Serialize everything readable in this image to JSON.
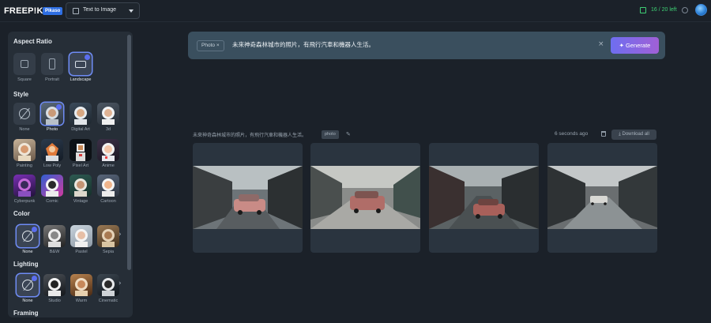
{
  "topbar": {
    "logo": "FREEP!K",
    "badge": "Pikaso",
    "mode": "Text to Image",
    "credits": "16 / 20 left"
  },
  "sidebar": {
    "aspect_title": "Aspect Ratio",
    "aspect_options": [
      "Square",
      "Portrait",
      "Landscape"
    ],
    "style_title": "Style",
    "style_options": [
      "None",
      "Photo",
      "Digital Art",
      "3d",
      "Painting",
      "Low Poly",
      "Pixel Art",
      "Anime",
      "Cyberpunk",
      "Comic",
      "Vintage",
      "Cartoon"
    ],
    "color_title": "Color",
    "color_options": [
      "None",
      "B&W",
      "Pastel",
      "Sepia"
    ],
    "lighting_title": "Lighting",
    "lighting_options": [
      "None",
      "Studio",
      "Warm",
      "Cinematic"
    ],
    "framing_title": "Framing"
  },
  "prompt": {
    "chip": "Photo",
    "text": "未來神奇森林城市的照片，有飛行汽車和機器人生活。",
    "generate": "Generate"
  },
  "result": {
    "prompt": "未來神奇森林城市的照片，有飛行汽車和機器人生活。",
    "tag": "photo",
    "time": "6 seconds ago",
    "download": "Download all",
    "image_count": 4
  },
  "colors": {
    "accent": "#6e6ef0",
    "credits": "#3ecf74",
    "background": "#1b2129"
  }
}
